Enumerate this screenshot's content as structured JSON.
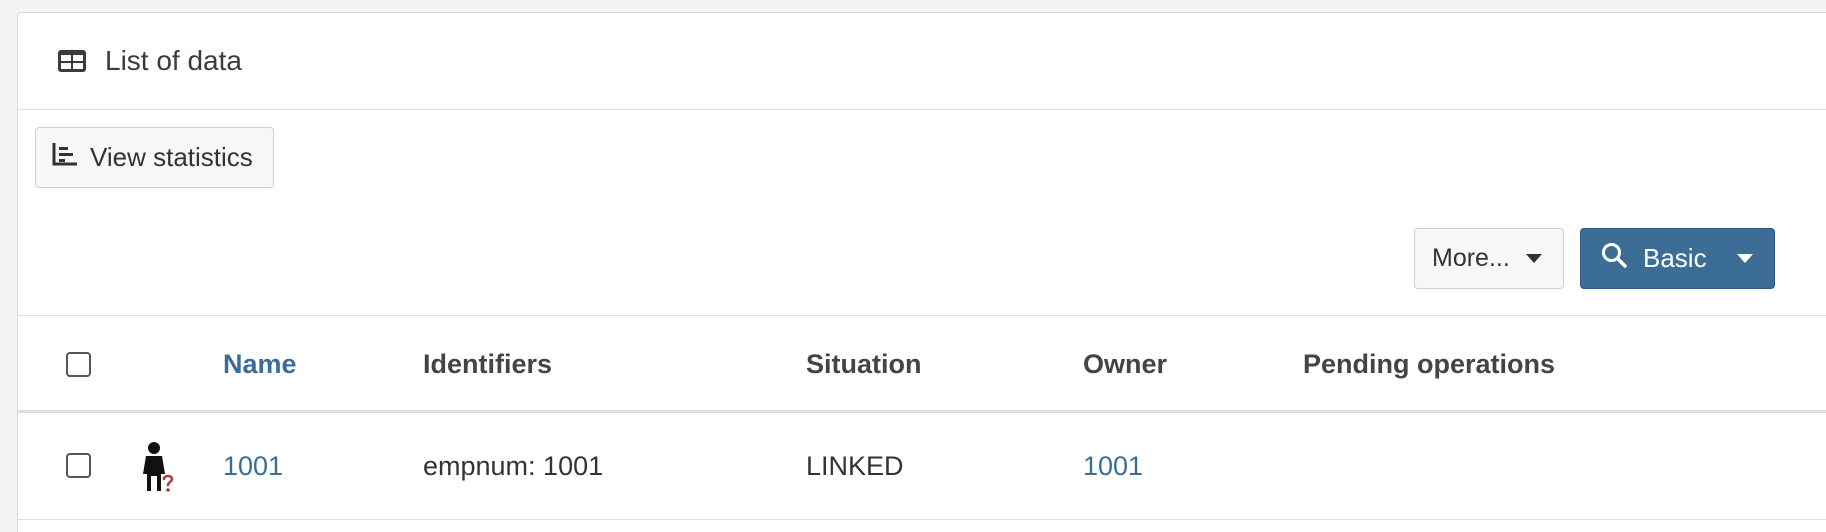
{
  "panel": {
    "title": "List of data",
    "title_icon": "table-icon"
  },
  "toolbar": {
    "stats_label": "View statistics",
    "stats_icon": "bar-chart-icon",
    "more_label": "More...",
    "basic_label": "Basic",
    "basic_icon": "search-icon"
  },
  "colors": {
    "accent": "#3b6d96",
    "unknown_mark": "#b03a3a"
  },
  "table": {
    "columns": [
      "Name",
      "Identifiers",
      "Situation",
      "Owner",
      "Pending operations"
    ],
    "rows": [
      {
        "icon": "person-unknown-icon",
        "name": "1001",
        "identifiers": "empnum: 1001",
        "situation": "LINKED",
        "owner": "1001",
        "pending": ""
      }
    ]
  }
}
